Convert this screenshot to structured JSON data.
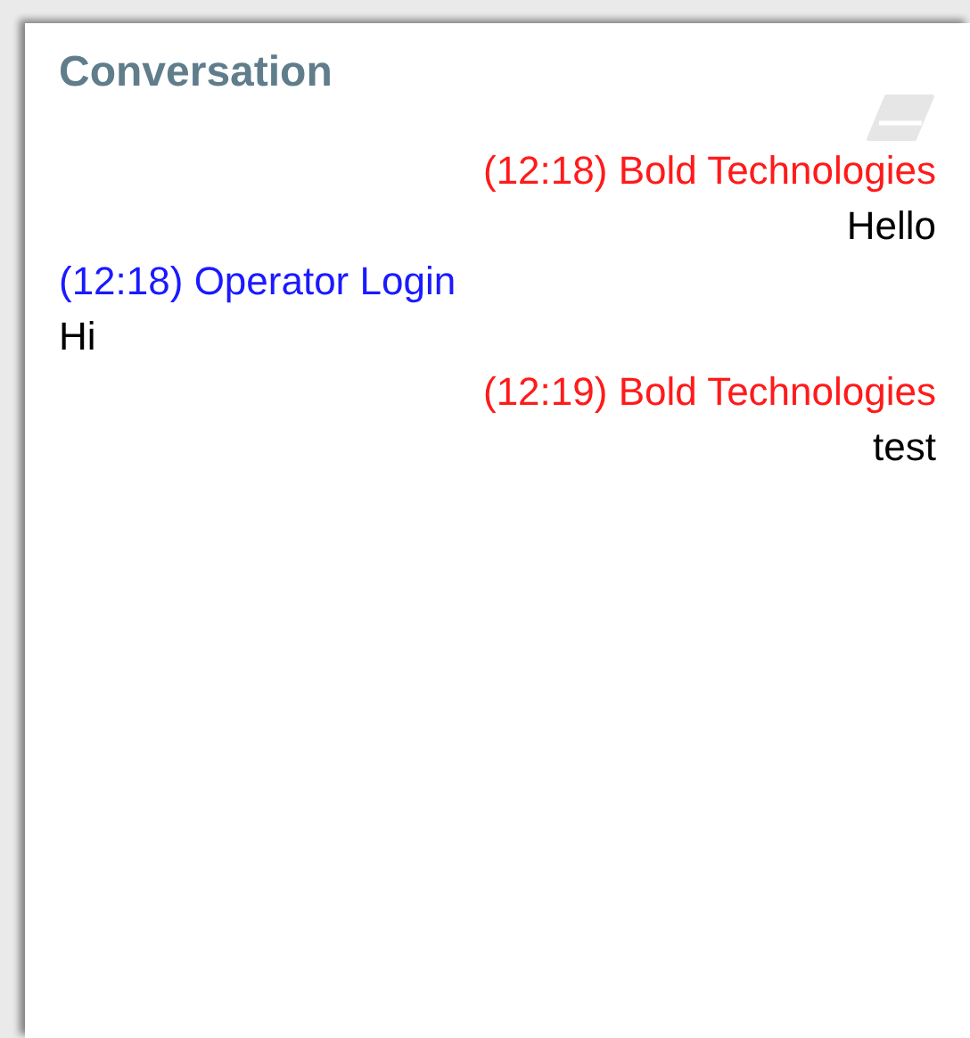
{
  "panel": {
    "title": "Conversation"
  },
  "messages": [
    {
      "kind": "agent",
      "color": "#ff1a1a",
      "header": "(12:18) Bold Technologies",
      "text": "Hello"
    },
    {
      "kind": "operator",
      "color": "#1a1aff",
      "header": "(12:18) Operator Login",
      "text": "Hi"
    },
    {
      "kind": "agent",
      "color": "#ff1a1a",
      "header": "(12:19) Bold Technologies",
      "text": "test"
    }
  ]
}
